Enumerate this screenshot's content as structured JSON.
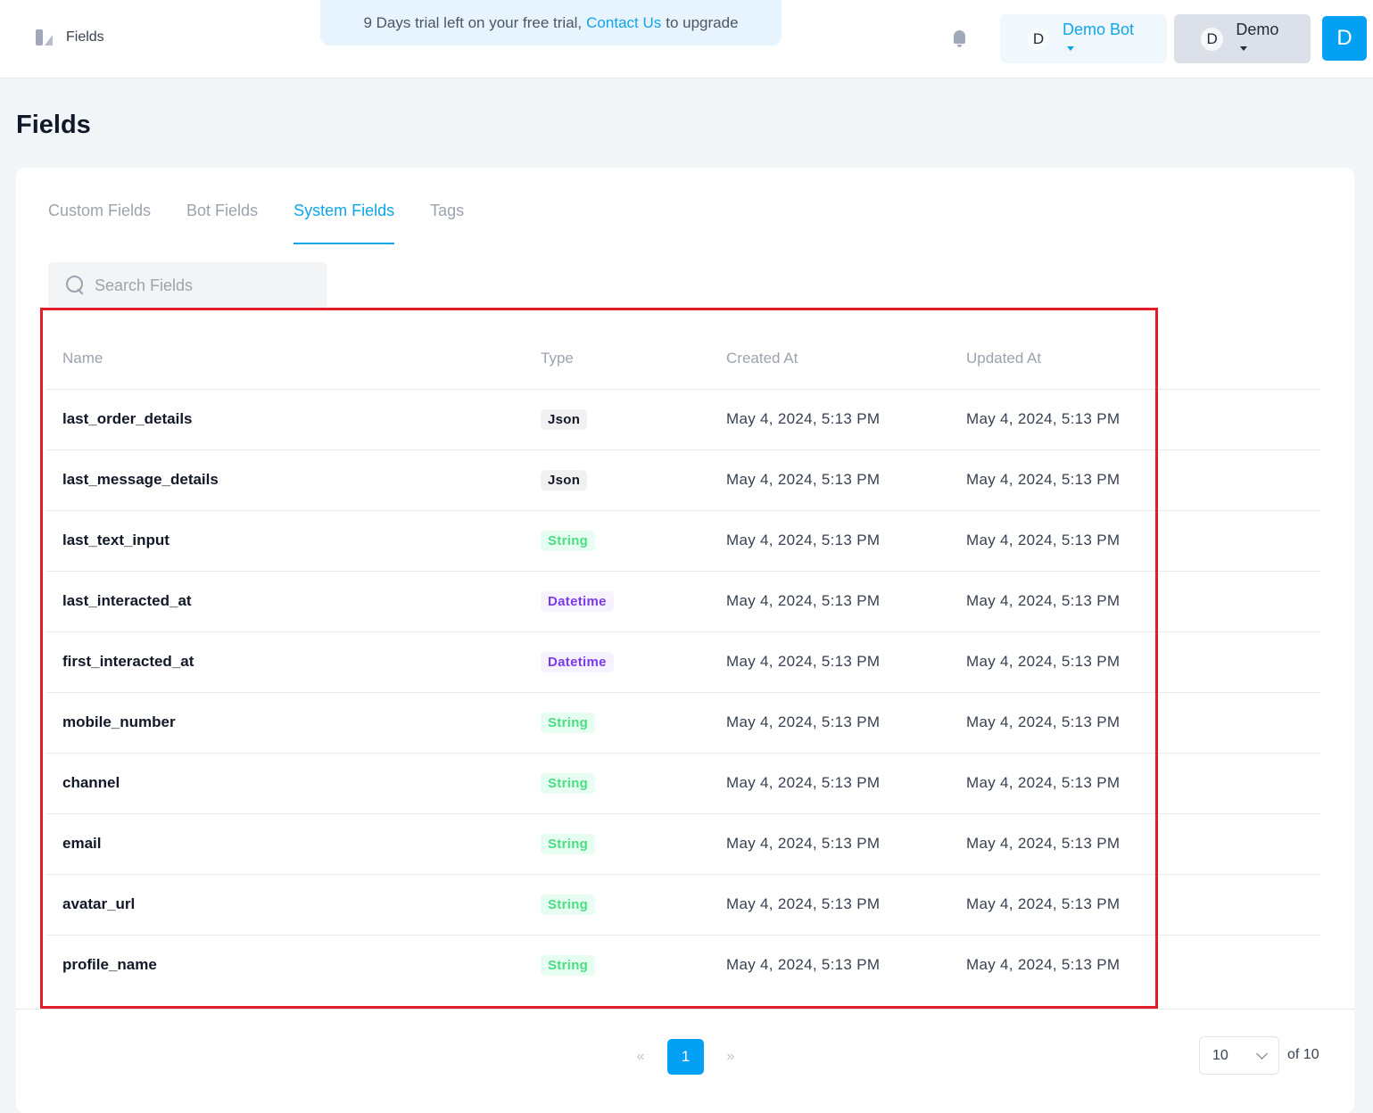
{
  "header": {
    "breadcrumb": "Fields",
    "trial_prefix": "9 Days trial left on your free trial,",
    "trial_link": "Contact Us",
    "trial_suffix": "to upgrade",
    "bot_avatar": "D",
    "bot_name": "Demo Bot",
    "workspace_avatar": "D",
    "workspace_name": "Demo",
    "user_avatar": "D"
  },
  "page": {
    "title": "Fields"
  },
  "tabs": [
    {
      "label": "Custom Fields"
    },
    {
      "label": "Bot Fields"
    },
    {
      "label": "System Fields",
      "active": true
    },
    {
      "label": "Tags"
    }
  ],
  "search": {
    "placeholder": "Search Fields",
    "value": ""
  },
  "table": {
    "columns": [
      "Name",
      "Type",
      "Created At",
      "Updated At"
    ],
    "rows": [
      {
        "name": "last_order_details",
        "type": "Json",
        "created": "May 4, 2024, 5:13 PM",
        "updated": "May 4, 2024, 5:13 PM"
      },
      {
        "name": "last_message_details",
        "type": "Json",
        "created": "May 4, 2024, 5:13 PM",
        "updated": "May 4, 2024, 5:13 PM"
      },
      {
        "name": "last_text_input",
        "type": "String",
        "created": "May 4, 2024, 5:13 PM",
        "updated": "May 4, 2024, 5:13 PM"
      },
      {
        "name": "last_interacted_at",
        "type": "Datetime",
        "created": "May 4, 2024, 5:13 PM",
        "updated": "May 4, 2024, 5:13 PM"
      },
      {
        "name": "first_interacted_at",
        "type": "Datetime",
        "created": "May 4, 2024, 5:13 PM",
        "updated": "May 4, 2024, 5:13 PM"
      },
      {
        "name": "mobile_number",
        "type": "String",
        "created": "May 4, 2024, 5:13 PM",
        "updated": "May 4, 2024, 5:13 PM"
      },
      {
        "name": "channel",
        "type": "String",
        "created": "May 4, 2024, 5:13 PM",
        "updated": "May 4, 2024, 5:13 PM"
      },
      {
        "name": "email",
        "type": "String",
        "created": "May 4, 2024, 5:13 PM",
        "updated": "May 4, 2024, 5:13 PM"
      },
      {
        "name": "avatar_url",
        "type": "String",
        "created": "May 4, 2024, 5:13 PM",
        "updated": "May 4, 2024, 5:13 PM"
      },
      {
        "name": "profile_name",
        "type": "String",
        "created": "May 4, 2024, 5:13 PM",
        "updated": "May 4, 2024, 5:13 PM"
      }
    ]
  },
  "pagination": {
    "prev": "«",
    "current_page": "1",
    "next": "»",
    "page_size": "10",
    "total_label": "of 10"
  },
  "colors": {
    "accent": "#03a0f4",
    "highlight": "#e11d2a"
  }
}
